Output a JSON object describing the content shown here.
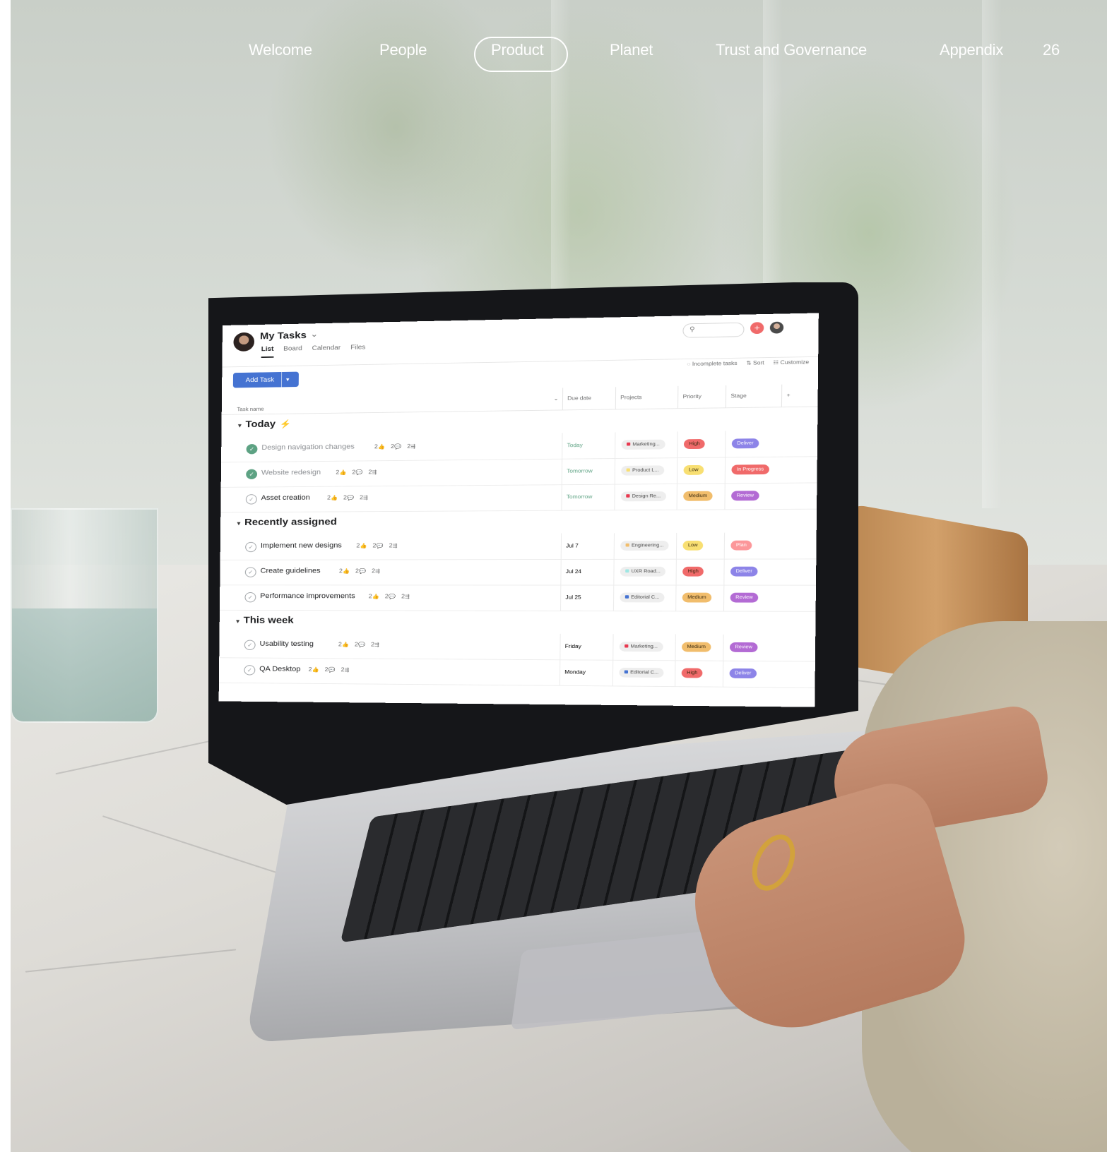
{
  "page_number": "26",
  "nav": {
    "items": [
      "Welcome",
      "People",
      "Product",
      "Planet",
      "Trust and Governance",
      "Appendix"
    ],
    "active": "Product"
  },
  "app": {
    "title": "My Tasks",
    "tabs": [
      "List",
      "Board",
      "Calendar",
      "Files"
    ],
    "active_tab": "List",
    "add_task_label": "Add Task",
    "toolbar": [
      "Incomplete tasks",
      "Sort",
      "Customize"
    ],
    "columns": {
      "task_name": "Task name",
      "due_date": "Due date",
      "projects": "Projects",
      "priority": "Priority",
      "stage": "Stage"
    },
    "sections": [
      {
        "title": "Today",
        "bolt": true,
        "tasks": [
          {
            "name": "Design navigation changes",
            "done": true,
            "likes": "2",
            "comments": "2",
            "subtasks": "2",
            "due": "Today",
            "project": "Marketing...",
            "project_color": "#e8384f",
            "priority": "High",
            "stage": "Deliver"
          },
          {
            "name": "Website redesign",
            "done": true,
            "likes": "2",
            "comments": "2",
            "subtasks": "2",
            "due": "Tomorrow",
            "project": "Product L...",
            "project_color": "#f8df72",
            "priority": "Low",
            "stage": "In Progress"
          },
          {
            "name": "Asset creation",
            "done": false,
            "likes": "2",
            "comments": "2",
            "subtasks": "2",
            "due": "Tomorrow",
            "project": "Design Re...",
            "project_color": "#e8384f",
            "priority": "Medium",
            "stage": "Review"
          }
        ]
      },
      {
        "title": "Recently assigned",
        "bolt": false,
        "tasks": [
          {
            "name": "Implement new designs",
            "done": false,
            "likes": "2",
            "comments": "2",
            "subtasks": "2",
            "due": "Jul 7",
            "project": "Engineering...",
            "project_color": "#f1bd6c",
            "priority": "Low",
            "stage": "Plan"
          },
          {
            "name": "Create guidelines",
            "done": false,
            "likes": "2",
            "comments": "2",
            "subtasks": "2",
            "due": "Jul 24",
            "project": "UXR Road...",
            "project_color": "#9ee7e3",
            "priority": "High",
            "stage": "Deliver"
          },
          {
            "name": "Performance improvements",
            "done": false,
            "likes": "2",
            "comments": "2",
            "subtasks": "2",
            "due": "Jul 25",
            "project": "Editorial C...",
            "project_color": "#4573d2",
            "priority": "Medium",
            "stage": "Review"
          }
        ]
      },
      {
        "title": "This week",
        "bolt": false,
        "tasks": [
          {
            "name": "Usability testing",
            "done": false,
            "likes": "2",
            "comments": "2",
            "subtasks": "2",
            "due": "Friday",
            "project": "Marketing...",
            "project_color": "#e8384f",
            "priority": "Medium",
            "stage": "Review"
          },
          {
            "name": "QA Desktop",
            "done": false,
            "likes": "2",
            "comments": "2",
            "subtasks": "2",
            "due": "Monday",
            "project": "Editorial C...",
            "project_color": "#4573d2",
            "priority": "High",
            "stage": "Deliver"
          }
        ]
      }
    ],
    "pill_colors": {
      "High": "#f06a6a",
      "Low": "#f8df72",
      "Medium": "#f1bd6c",
      "Deliver": "#8d84e8",
      "In Progress": "#f06a6a",
      "Review": "#b36bd4",
      "Plan": "#fc979a"
    }
  }
}
